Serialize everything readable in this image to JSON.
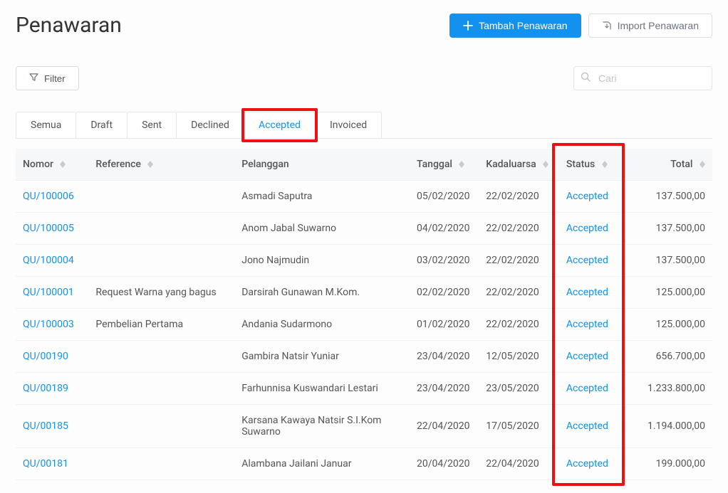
{
  "header": {
    "title": "Penawaran",
    "add_label": "Tambah Penawaran",
    "import_label": "Import Penawaran"
  },
  "toolbar": {
    "filter_label": "Filter",
    "search_placeholder": "Cari"
  },
  "tabs": [
    {
      "label": "Semua",
      "active": false
    },
    {
      "label": "Draft",
      "active": false
    },
    {
      "label": "Sent",
      "active": false
    },
    {
      "label": "Declined",
      "active": false
    },
    {
      "label": "Accepted",
      "active": true
    },
    {
      "label": "Invoiced",
      "active": false
    }
  ],
  "table": {
    "columns": {
      "nomor": "Nomor",
      "reference": "Reference",
      "pelanggan": "Pelanggan",
      "tanggal": "Tanggal",
      "kadaluarsa": "Kadaluarsa",
      "status": "Status",
      "total": "Total"
    },
    "rows": [
      {
        "nomor": "QU/100006",
        "reference": "",
        "pelanggan": "Asmadi Saputra",
        "tanggal": "05/02/2020",
        "kadaluarsa": "22/02/2020",
        "status": "Accepted",
        "total": "137.500,00"
      },
      {
        "nomor": "QU/100005",
        "reference": "",
        "pelanggan": "Anom Jabal Suwarno",
        "tanggal": "04/02/2020",
        "kadaluarsa": "22/02/2020",
        "status": "Accepted",
        "total": "137.500,00"
      },
      {
        "nomor": "QU/100004",
        "reference": "",
        "pelanggan": "Jono Najmudin",
        "tanggal": "03/02/2020",
        "kadaluarsa": "22/02/2020",
        "status": "Accepted",
        "total": "137.500,00"
      },
      {
        "nomor": "QU/100001",
        "reference": "Request Warna yang bagus",
        "pelanggan": "Darsirah Gunawan M.Kom.",
        "tanggal": "02/02/2020",
        "kadaluarsa": "22/02/2020",
        "status": "Accepted",
        "total": "125.000,00"
      },
      {
        "nomor": "QU/100003",
        "reference": "Pembelian Pertama",
        "pelanggan": "Andania Sudarmono",
        "tanggal": "01/02/2020",
        "kadaluarsa": "22/02/2020",
        "status": "Accepted",
        "total": "125.000,00"
      },
      {
        "nomor": "QU/00190",
        "reference": "",
        "pelanggan": "Gambira Natsir Yuniar",
        "tanggal": "23/04/2020",
        "kadaluarsa": "12/05/2020",
        "status": "Accepted",
        "total": "656.700,00"
      },
      {
        "nomor": "QU/00189",
        "reference": "",
        "pelanggan": "Farhunnisa Kuswandari Lestari",
        "tanggal": "23/04/2020",
        "kadaluarsa": "23/05/2020",
        "status": "Accepted",
        "total": "1.233.800,00"
      },
      {
        "nomor": "QU/00185",
        "reference": "",
        "pelanggan": "Karsana Kawaya Natsir S.I.Kom Suwarno",
        "tanggal": "22/04/2020",
        "kadaluarsa": "17/05/2020",
        "status": "Accepted",
        "total": "1.194.000,00"
      },
      {
        "nomor": "QU/00181",
        "reference": "",
        "pelanggan": "Alambana Jailani Januar",
        "tanggal": "20/04/2020",
        "kadaluarsa": "22/04/2020",
        "status": "Accepted",
        "total": "199.000,00"
      }
    ]
  }
}
